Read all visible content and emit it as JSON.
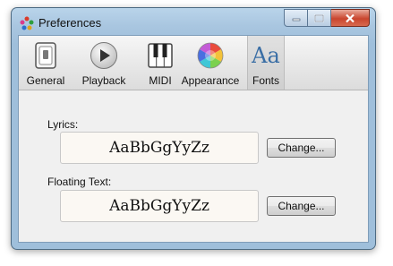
{
  "window": {
    "title": "Preferences"
  },
  "toolbar": {
    "tabs": [
      {
        "label": "General",
        "icon": "switch-icon"
      },
      {
        "label": "Playback",
        "icon": "play-icon"
      },
      {
        "label": "MIDI",
        "icon": "piano-keys-icon"
      },
      {
        "label": "Appearance",
        "icon": "color-wheel-icon"
      },
      {
        "label": "Fonts",
        "icon": "fonts-icon",
        "icon_text": "Aa",
        "active": true
      }
    ]
  },
  "fonts": {
    "lyrics": {
      "label": "Lyrics:",
      "sample": "AaBbGgYyZz",
      "button": "Change..."
    },
    "floating_text": {
      "label": "Floating Text:",
      "sample": "AaBbGgYyZz",
      "button": "Change..."
    }
  },
  "colors": {
    "title_bar": "#a9c6e0",
    "close_button": "#c9452e",
    "active_tab_icon": "#3a6ea5"
  }
}
